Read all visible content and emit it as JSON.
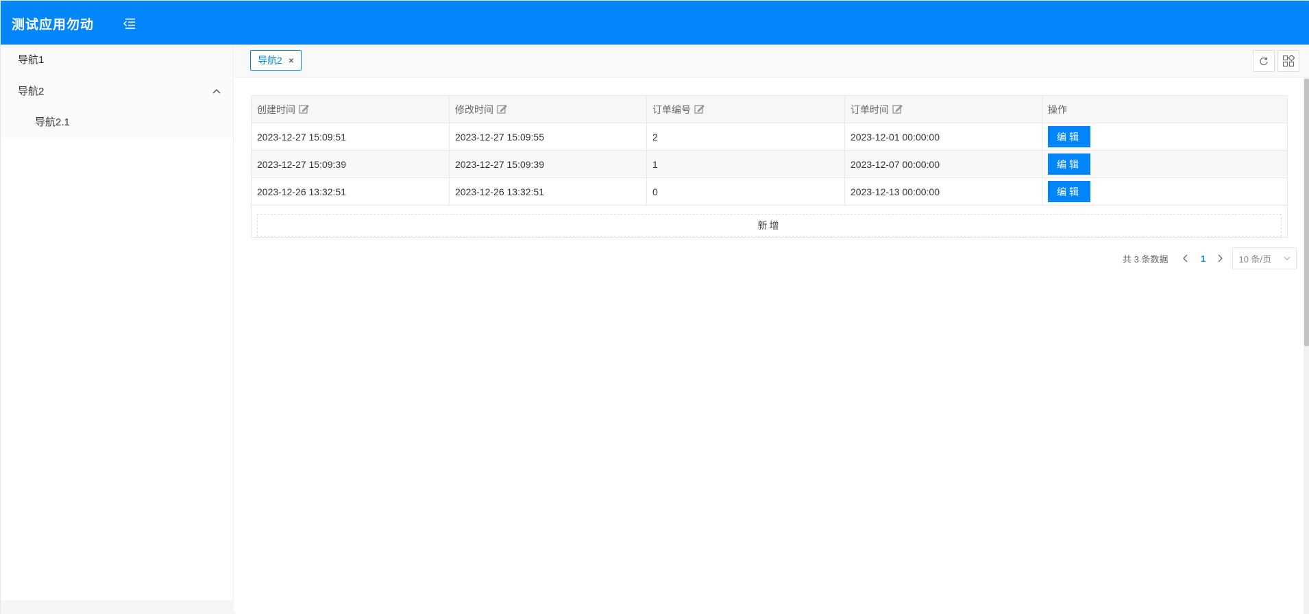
{
  "header": {
    "app_title": "测试应用勿动"
  },
  "sidebar": {
    "items": [
      {
        "label": "导航1"
      },
      {
        "label": "导航2"
      },
      {
        "label": "导航2.1"
      }
    ]
  },
  "tabs": [
    {
      "label": "导航2",
      "close": "×"
    }
  ],
  "table": {
    "columns": [
      "创建时间",
      "修改时间",
      "订单编号",
      "订单时间",
      "操作"
    ],
    "rows": [
      {
        "created": "2023-12-27 15:09:51",
        "modified": "2023-12-27 15:09:55",
        "order_no": "2",
        "order_time": "2023-12-01 00:00:00",
        "action": "编辑"
      },
      {
        "created": "2023-12-27 15:09:39",
        "modified": "2023-12-27 15:09:39",
        "order_no": "1",
        "order_time": "2023-12-07 00:00:00",
        "action": "编辑"
      },
      {
        "created": "2023-12-26 13:32:51",
        "modified": "2023-12-26 13:32:51",
        "order_no": "0",
        "order_time": "2023-12-13 00:00:00",
        "action": "编辑"
      }
    ],
    "add_label": "新增"
  },
  "pagination": {
    "total_text": "共 3 条数据",
    "current_page": "1",
    "page_size": "10 条/页"
  },
  "colors": {
    "primary": "#0386f9",
    "header_bg": "#0386f9"
  }
}
